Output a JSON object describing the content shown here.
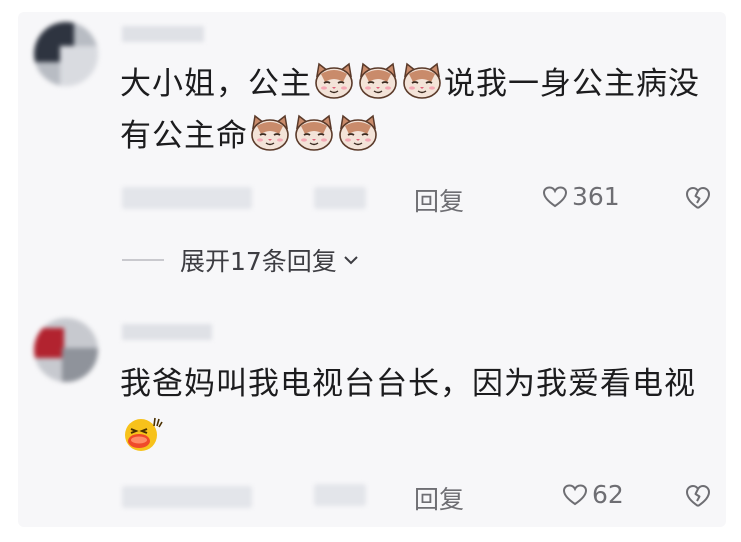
{
  "comments": [
    {
      "text_a": "大小姐，公主",
      "text_b": "说我一身公主病没有公主命",
      "reply_label": "回复",
      "likes": "361",
      "expand_label": "展开17条回复"
    },
    {
      "text": "我爸妈叫我电视台台长，因为我爱看电视",
      "reply_label": "回复",
      "likes": "62"
    }
  ],
  "colors": {
    "card_bg": "#f7f7f9",
    "text": "#1c1c1e",
    "meta_text": "#6e6e73"
  },
  "icons": [
    "cat-emoji-icon",
    "laughing-emoji-icon",
    "heart-icon",
    "broken-heart-icon",
    "chevron-down-icon"
  ]
}
